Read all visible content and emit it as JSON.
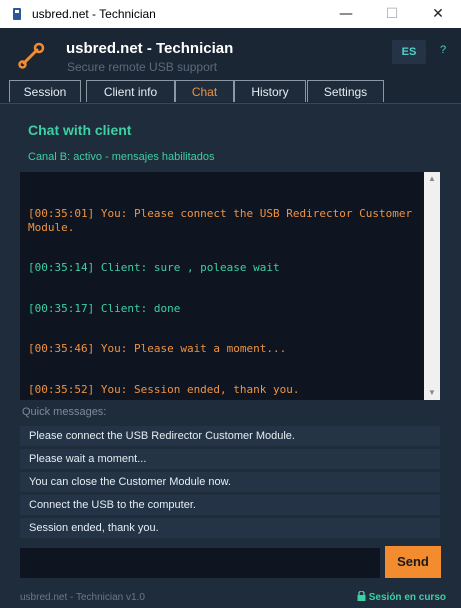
{
  "window": {
    "title": "usbred.net - Technician",
    "controls": {
      "minimize": "—",
      "maximize": "☐",
      "close": "✕"
    }
  },
  "header": {
    "brand": "usbred.net - Technician",
    "tagline": "Secure remote USB support",
    "lang": "ES",
    "help": "?"
  },
  "tabs": [
    {
      "label": "Session",
      "active": false
    },
    {
      "label": "Client info",
      "active": false
    },
    {
      "label": "Chat",
      "active": true
    },
    {
      "label": "History",
      "active": false
    },
    {
      "label": "Settings",
      "active": false
    }
  ],
  "chat": {
    "title": "Chat with client",
    "channel_status": "Canal B: activo - mensajes habilitados",
    "log": [
      {
        "who": "you",
        "text": "[00:35:01] You: Please connect the USB Redirector Customer Module."
      },
      {
        "who": "client",
        "text": "[00:35:14] Client: sure , polease wait"
      },
      {
        "who": "client",
        "text": "[00:35:17] Client: done"
      },
      {
        "who": "you",
        "text": "[00:35:46] You: Please wait a moment..."
      },
      {
        "who": "you",
        "text": "[00:35:52] You: Session ended, thank you."
      }
    ]
  },
  "quick": {
    "label": "Quick messages:",
    "items": [
      "Please connect the USB Redirector Customer Module.",
      "Please wait a moment...",
      "You can close the Customer Module now.",
      "Connect the USB to the computer.",
      "Session ended, thank you."
    ]
  },
  "composer": {
    "value": "",
    "send_label": "Send"
  },
  "footer": {
    "version": "usbred.net - Technician v1.0",
    "status": "Sesión en curso"
  },
  "colors": {
    "accent_orange": "#f28c2e",
    "accent_green": "#3ecfa4",
    "background": "#1f2c3b"
  }
}
